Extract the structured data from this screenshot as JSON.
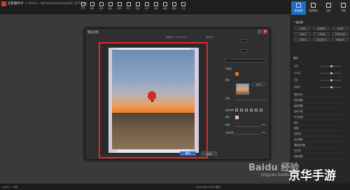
{
  "app": {
    "title": "光影魔术手",
    "file_path": "C:\\Users\\...\\Windows\\Desktop\\DSC_0072.jpg"
  },
  "toolbar": {
    "items": [
      "打开",
      "保存",
      "另存",
      "裁剪",
      "旋转",
      "尺寸",
      "画笔",
      "文字",
      "边框",
      "拼图",
      "抠图",
      "上传"
    ]
  },
  "right_panel": {
    "tabs": [
      "基本调整",
      "数码暗房",
      "边框",
      "玩图"
    ],
    "section_one_key": "一键设置",
    "quick_buttons": [
      "一键美化",
      "自动曝光",
      "白平衡",
      "一键补光",
      "一键减光",
      "严重白平衡",
      "一键锐化",
      "自动对比度",
      "数码补光"
    ],
    "section_basic": "基本",
    "sliders": [
      {
        "label": "亮度",
        "value": 0.5
      },
      {
        "label": "对比度",
        "value": 0.5
      },
      {
        "label": "色相",
        "value": 0.5
      },
      {
        "label": "饱和度",
        "value": 0.5
      }
    ],
    "list": [
      "数码补光",
      "色阶调整",
      "曲线调整",
      "色彩平衡",
      "RGB色调",
      "锐化",
      "模糊",
      "去雾镜",
      "色彩替换",
      "通道混合器",
      "白平衡",
      "高级调整"
    ]
  },
  "dialog": {
    "title": "撕边边框",
    "info_left": "原图尺寸：800×600",
    "info_right": "预览尺寸",
    "controls": {
      "opacity_label": "透明度",
      "pattern_label": "图案",
      "fill_label": "边框",
      "custom_button": "自定义",
      "edge_label": "撕边效果",
      "shadow_label": "阴影",
      "blur_label": "模糊",
      "width_label": "边框宽度",
      "blur_value": "100",
      "width_value": "100"
    },
    "ok_label": "确定",
    "cancel_label": "取消",
    "accent_color": "#2c74c9",
    "frame_color": "#e3252f"
  },
  "status": {
    "left": "100%    一一般",
    "mid": "800×600    100%    图片"
  },
  "watermark": {
    "brand": "Baidu 经验",
    "url": "jingyan.baidu.com",
    "site": "京华手游"
  }
}
